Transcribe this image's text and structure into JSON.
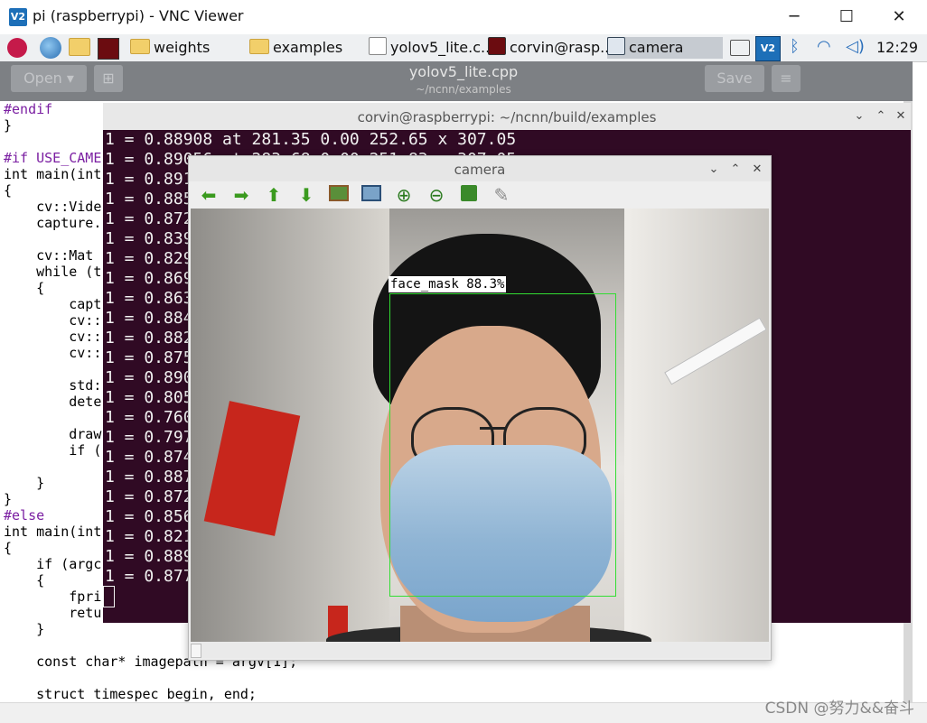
{
  "vnc_window": {
    "title": "pi (raspberrypi) - VNC Viewer",
    "logo": "V2"
  },
  "taskbar": {
    "items": [
      {
        "label": "weights",
        "icon": "folder-icon"
      },
      {
        "label": "examples",
        "icon": "folder-icon"
      },
      {
        "label": "yolov5_lite.c...",
        "icon": "text-editor-icon"
      },
      {
        "label": "corvin@rasp...",
        "icon": "terminal-icon"
      },
      {
        "label": "camera",
        "icon": "window-icon"
      }
    ],
    "tray_vnc": "V2",
    "clock": "12:29"
  },
  "editor": {
    "open_label": "Open",
    "save_label": "Save",
    "title": "yolov5_lite.cpp",
    "path": "~/ncnn/examples",
    "code": [
      "#endif",
      "}",
      "",
      "#if USE_CAME",
      "int main(int",
      "{",
      "    cv::Vide",
      "    capture.",
      "",
      "    cv::Mat ",
      "    while (t",
      "    {",
      "        capt",
      "        cv::",
      "        cv::",
      "        cv::",
      "",
      "        std:",
      "        dete",
      "",
      "        draw",
      "        if (",
      "",
      "    }",
      "}",
      "#else",
      "int main(int",
      "{",
      "    if (argc",
      "    {",
      "        fpri",
      "        retu",
      "    }",
      "",
      "    const char* imagepath = argv[1];",
      "",
      "    struct timespec begin, end;"
    ]
  },
  "terminal": {
    "title": "corvin@raspberrypi: ~/ncnn/build/examples",
    "lines": [
      "1 = 0.88908 at 281.35 0.00 252.65 x 307.05",
      "1 = 0.89056 at 283.68 0.00 251.83 x 307.05",
      "1 = 0.891",
      "1 = 0.885",
      "1 = 0.872",
      "1 = 0.839",
      "1 = 0.829",
      "1 = 0.869",
      "1 = 0.863",
      "1 = 0.884",
      "1 = 0.882",
      "1 = 0.875",
      "1 = 0.890",
      "1 = 0.805",
      "1 = 0.760",
      "1 = 0.797",
      "1 = 0.874",
      "1 = 0.887",
      "1 = 0.872",
      "1 = 0.856",
      "1 = 0.821",
      "1 = 0.889",
      "1 = 0.877"
    ]
  },
  "camera": {
    "title": "camera",
    "detection_label": "face_mask 88.3%",
    "detection_color": "#33dd33",
    "toolbar_icons": [
      "arrow-left-icon",
      "arrow-right-icon",
      "arrow-up-icon",
      "arrow-down-icon",
      "image-icon",
      "fit-window-icon",
      "zoom-in-icon",
      "zoom-out-icon",
      "save-icon",
      "properties-icon"
    ]
  },
  "watermark": "CSDN @努力&&奋斗"
}
